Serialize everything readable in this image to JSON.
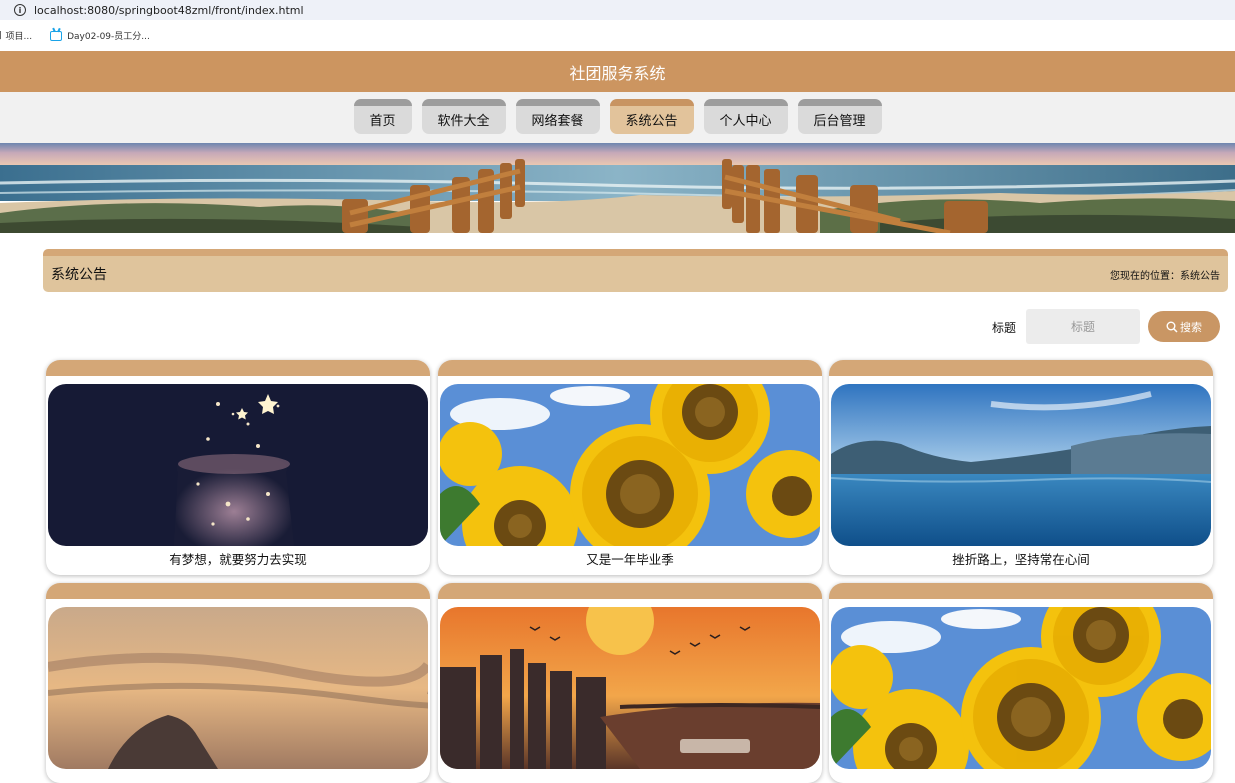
{
  "browser": {
    "url": "localhost:8080/springboot48zml/front/index.html",
    "bookmarks": [
      {
        "label": "项目..."
      },
      {
        "label": "Day02-09-员工分..."
      }
    ]
  },
  "site": {
    "title": "社团服务系统",
    "nav": [
      {
        "label": "首页",
        "active": false
      },
      {
        "label": "软件大全",
        "active": false
      },
      {
        "label": "网络套餐",
        "active": false
      },
      {
        "label": "系统公告",
        "active": true
      },
      {
        "label": "个人中心",
        "active": false
      },
      {
        "label": "后台管理",
        "active": false
      }
    ]
  },
  "breadcrumb": {
    "title": "系统公告",
    "location": "您现在的位置：系统公告"
  },
  "search": {
    "label": "标题",
    "placeholder": "标题",
    "value": "",
    "button_label": "搜索"
  },
  "cards": [
    {
      "title": "有梦想，就要努力去实现",
      "image": "starry-jar"
    },
    {
      "title": "又是一年毕业季",
      "image": "sunflowers"
    },
    {
      "title": "挫折路上，坚持常在心间",
      "image": "mountain-lake"
    },
    {
      "title": "",
      "image": "sunset-sky"
    },
    {
      "title": "",
      "image": "city-river-sunset"
    },
    {
      "title": "",
      "image": "sunflowers"
    }
  ],
  "colors": {
    "header": "#cc9560",
    "accent": "#d4a777",
    "active_tab": "#e2c39b",
    "search_button": "#c99664"
  }
}
